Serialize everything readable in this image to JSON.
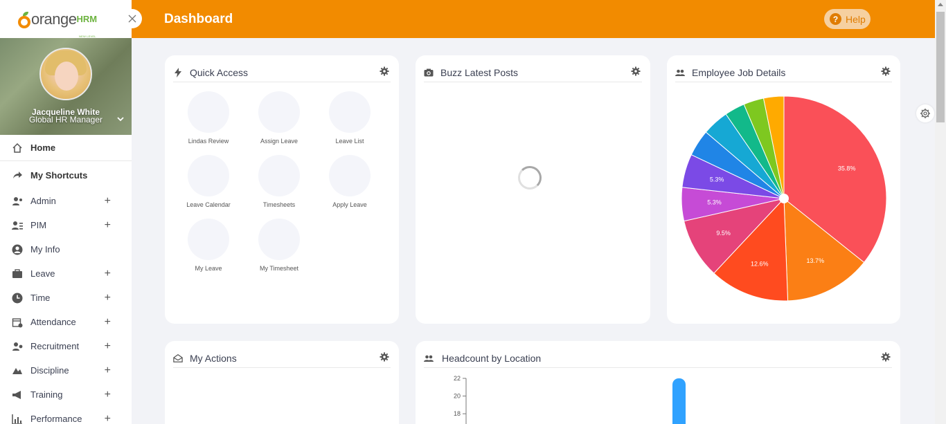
{
  "brand": {
    "word": "orange",
    "suffix": "HRM",
    "tagline": "NEW LEVEL OF HR MANAGEMENT"
  },
  "profile": {
    "name": "Jacqueline White",
    "role": "Global HR Manager"
  },
  "menu": {
    "home": "Home",
    "shortcuts": "My Shortcuts",
    "items": [
      {
        "label": "Admin",
        "expandable": true,
        "icon": "admin-icon"
      },
      {
        "label": "PIM",
        "expandable": true,
        "icon": "pim-icon"
      },
      {
        "label": "My Info",
        "expandable": false,
        "icon": "user-icon"
      },
      {
        "label": "Leave",
        "expandable": true,
        "icon": "briefcase-icon"
      },
      {
        "label": "Time",
        "expandable": true,
        "icon": "clock-icon"
      },
      {
        "label": "Attendance",
        "expandable": true,
        "icon": "calendar-icon"
      },
      {
        "label": "Recruitment",
        "expandable": true,
        "icon": "recruit-icon"
      },
      {
        "label": "Discipline",
        "expandable": true,
        "icon": "discipline-icon"
      },
      {
        "label": "Training",
        "expandable": true,
        "icon": "megaphone-icon"
      },
      {
        "label": "Performance",
        "expandable": true,
        "icon": "chart-icon"
      }
    ],
    "plus": "+"
  },
  "header": {
    "title": "Dashboard",
    "help": "Help",
    "help_icon": "?"
  },
  "cards": {
    "quick_access": {
      "title": "Quick Access",
      "items": [
        "Lindas Review",
        "Assign Leave",
        "Leave List",
        "Leave Calendar",
        "Timesheets",
        "Apply Leave",
        "My Leave",
        "My Timesheet"
      ]
    },
    "buzz": {
      "title": "Buzz Latest Posts"
    },
    "job_details": {
      "title": "Employee Job Details"
    },
    "my_actions": {
      "title": "My Actions"
    },
    "headcount": {
      "title": "Headcount by Location"
    }
  },
  "chart_data": [
    {
      "type": "pie",
      "title": "Employee Job Details",
      "labels": [
        "35.8%",
        "13.7%",
        "12.6%",
        "9.5%",
        "5.3%",
        "5.3%",
        "",
        "",
        "",
        "",
        ""
      ],
      "values": [
        35.8,
        13.7,
        12.6,
        9.5,
        5.3,
        5.3,
        4.2,
        4.2,
        3.2,
        3.2,
        3.2
      ],
      "colors": [
        "#fa5058",
        "#fb7f15",
        "#ff4b1f",
        "#e5437a",
        "#c64bd6",
        "#7b4ae6",
        "#2085e6",
        "#16a8d4",
        "#12b98a",
        "#7ec820",
        "#ffaa00"
      ]
    },
    {
      "type": "bar",
      "title": "Headcount by Location",
      "ylim": [
        17,
        22
      ],
      "yticks": [
        22,
        20,
        18
      ],
      "values": [
        22
      ],
      "colors": [
        "#30a2ff"
      ]
    }
  ]
}
